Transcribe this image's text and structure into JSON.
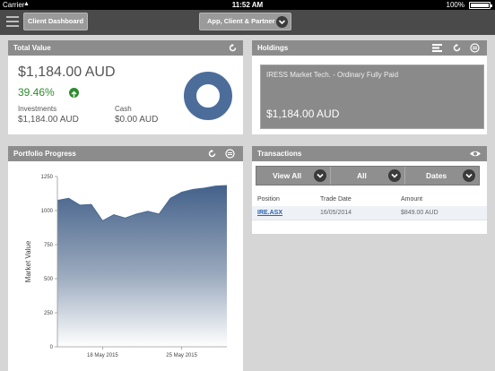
{
  "status_bar": {
    "carrier": "Carrier",
    "time": "11:52 AM",
    "battery": "100%"
  },
  "navbar": {
    "dashboard_button": "Client Dashboard",
    "scope_select": "App, Client & Partner"
  },
  "total_value": {
    "title": "Total Value",
    "amount": "$1,184.00 AUD",
    "change_pct": "39.46%",
    "investments_label": "Investments",
    "investments_value": "$1,184.00 AUD",
    "cash_label": "Cash",
    "cash_value": "$0.00 AUD",
    "donut_color": "#4c6d9a"
  },
  "holdings": {
    "title": "Holdings",
    "items": [
      {
        "name": "IRESS Market Tech. - Ordinary Fully Paid",
        "value": "$1,184.00 AUD"
      }
    ]
  },
  "portfolio_progress": {
    "title": "Portfolio Progress"
  },
  "transactions": {
    "title": "Transactions",
    "filters": [
      "View All",
      "All",
      "Dates"
    ],
    "columns": [
      "Position",
      "Trade Date",
      "Amount"
    ],
    "rows": [
      {
        "position": "IRE.ASX",
        "trade_date": "16/05/2014",
        "amount": "$849.00 AUD"
      }
    ]
  },
  "chart_data": {
    "type": "area",
    "title": "",
    "xlabel": "",
    "ylabel": "Market Value",
    "ylim": [
      0,
      1250
    ],
    "yticks": [
      0,
      250,
      500,
      750,
      1000,
      1250
    ],
    "xtick_labels": [
      "18 May 2015",
      "25 May 2015"
    ],
    "x": [
      "14 May 2015",
      "15 May 2015",
      "16 May 2015",
      "17 May 2015",
      "18 May 2015",
      "19 May 2015",
      "20 May 2015",
      "21 May 2015",
      "22 May 2015",
      "23 May 2015",
      "24 May 2015",
      "25 May 2015",
      "26 May 2015",
      "27 May 2015",
      "28 May 2015",
      "29 May 2015"
    ],
    "values": [
      1075,
      1090,
      1040,
      1045,
      925,
      970,
      945,
      975,
      995,
      975,
      1090,
      1135,
      1155,
      1165,
      1180,
      1184
    ],
    "grid": false,
    "series_color": "#4a6a93"
  }
}
